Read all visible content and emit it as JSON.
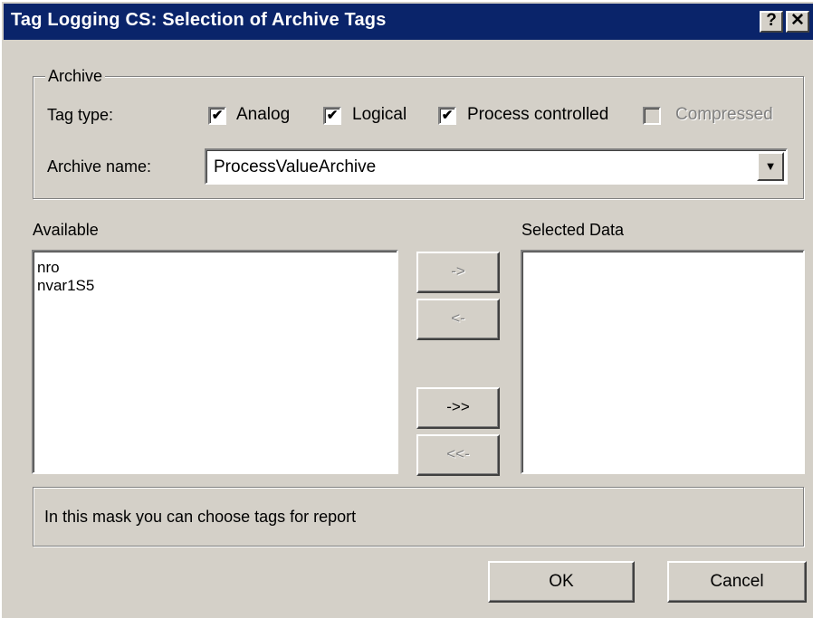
{
  "window": {
    "title": "Tag Logging CS: Selection of Archive Tags",
    "help_button": "?",
    "close_button": "✕",
    "title_bar_color": "#0a246a"
  },
  "archive_group": {
    "legend": "Archive",
    "tag_type_label": "Tag type:",
    "checkboxes": [
      {
        "label": "Analog",
        "checked": true,
        "enabled": true
      },
      {
        "label": "Logical",
        "checked": true,
        "enabled": true
      },
      {
        "label": "Process controlled",
        "checked": true,
        "enabled": true
      },
      {
        "label": "Compressed",
        "checked": false,
        "enabled": false
      }
    ],
    "archive_name_label": "Archive name:",
    "archive_name_value": "ProcessValueArchive",
    "dropdown_icon": "chevron-down-icon"
  },
  "available": {
    "label": "Available",
    "items": [
      "nro",
      "nvar1S5"
    ]
  },
  "selected": {
    "label": "Selected Data",
    "items": []
  },
  "transfer_buttons": {
    "add": "->",
    "remove": "<-",
    "add_all": "->>",
    "remove_all": "<<-"
  },
  "info_text": "In this mask you can choose tags for report",
  "footer": {
    "ok_label": "OK",
    "cancel_label": "Cancel"
  }
}
